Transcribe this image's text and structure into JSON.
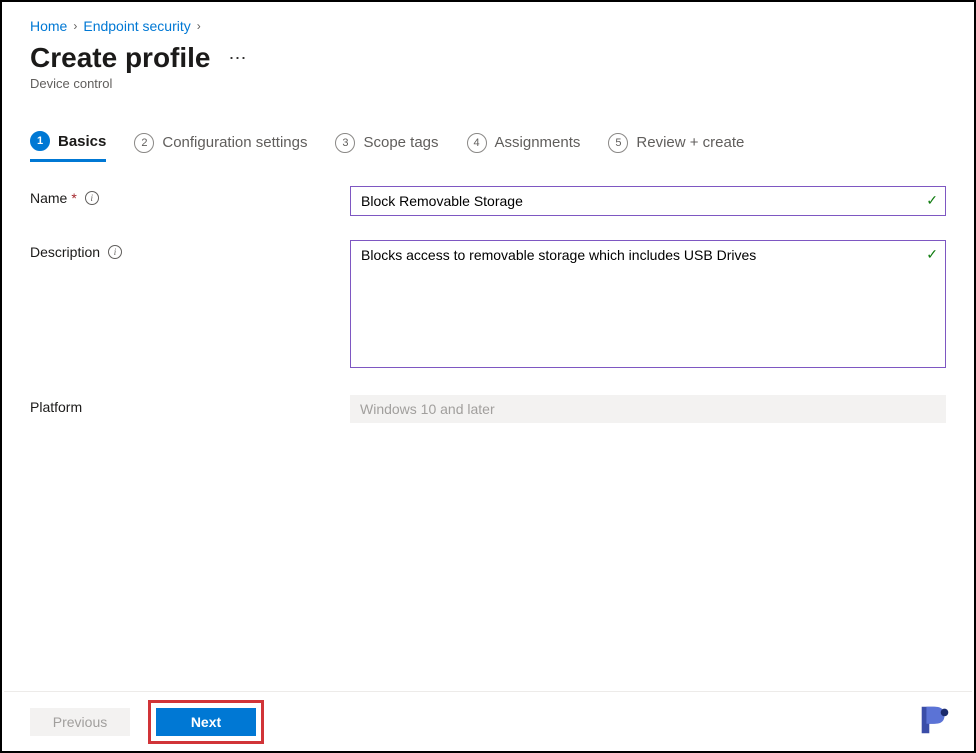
{
  "breadcrumb": {
    "items": [
      {
        "label": "Home"
      },
      {
        "label": "Endpoint security"
      }
    ]
  },
  "header": {
    "title": "Create profile",
    "subtitle": "Device control"
  },
  "tabs": [
    {
      "num": "1",
      "label": "Basics",
      "active": true
    },
    {
      "num": "2",
      "label": "Configuration settings",
      "active": false
    },
    {
      "num": "3",
      "label": "Scope tags",
      "active": false
    },
    {
      "num": "4",
      "label": "Assignments",
      "active": false
    },
    {
      "num": "5",
      "label": "Review + create",
      "active": false
    }
  ],
  "form": {
    "name": {
      "label": "Name",
      "required": true,
      "value": "Block Removable Storage"
    },
    "description": {
      "label": "Description",
      "required": false,
      "value": "Blocks access to removable storage which includes USB Drives"
    },
    "platform": {
      "label": "Platform",
      "value": "Windows 10 and later"
    }
  },
  "footer": {
    "previous": "Previous",
    "next": "Next"
  }
}
